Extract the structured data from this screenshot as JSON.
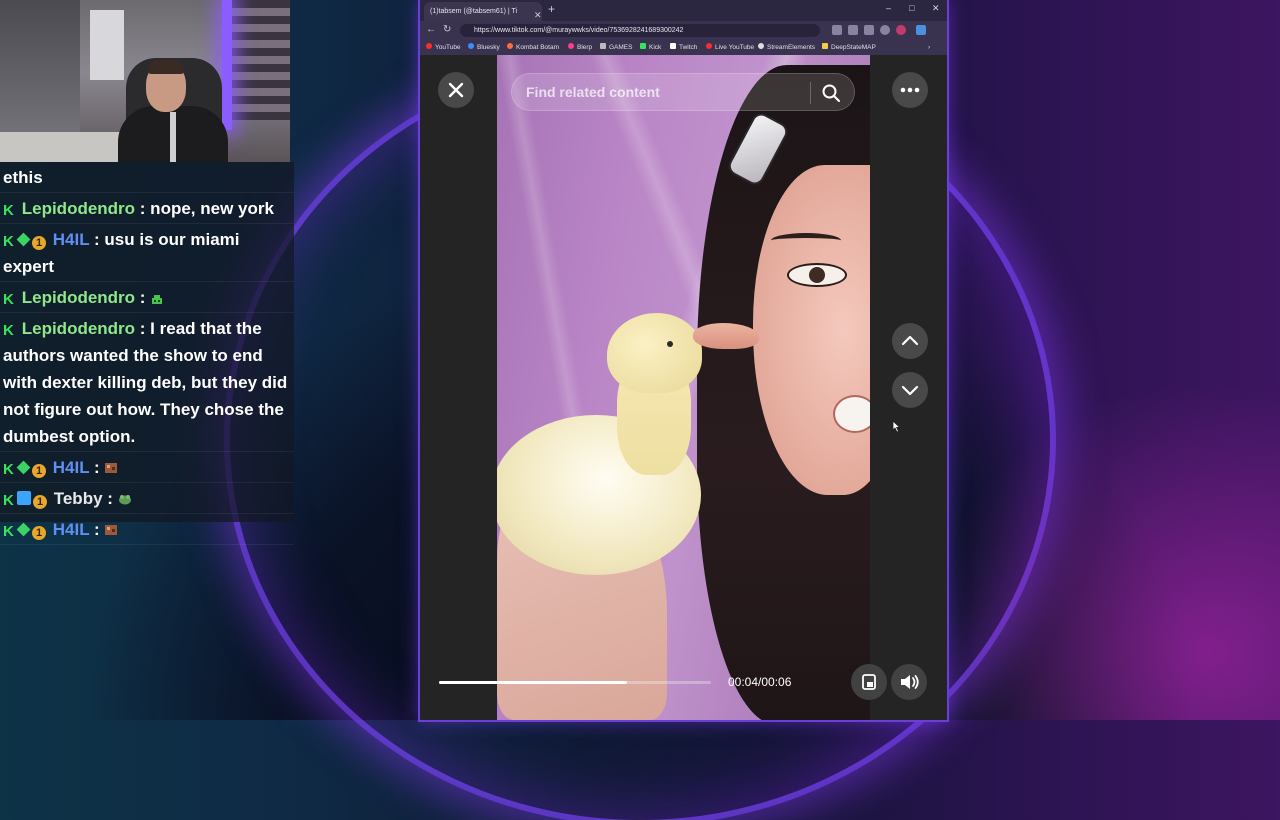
{
  "chat": {
    "messages": [
      {
        "user": "",
        "text": "ethis",
        "badges": []
      },
      {
        "user": "Lepidodendro",
        "text": ": nope, new york",
        "color": "green",
        "badges": [
          "k"
        ]
      },
      {
        "user": "H4IL",
        "text": ": usu is our miami expert",
        "color": "blue",
        "badges": [
          "k",
          "g",
          "c"
        ]
      },
      {
        "user": "Lepidodendro",
        "text": ":",
        "color": "green",
        "badges": [
          "k"
        ],
        "emote": "green-pixel-emote"
      },
      {
        "user": "Lepidodendro",
        "text": ": I read that the authors wanted the show to end with dexter killing deb, but they did not figure out how. They chose the dumbest option.",
        "color": "green",
        "badges": [
          "k"
        ]
      },
      {
        "user": "H4IL",
        "text": ":",
        "color": "blue",
        "badges": [
          "k",
          "g",
          "c"
        ],
        "emote": "brown-pixel-emote"
      },
      {
        "user": "Tebby",
        "text": ":",
        "color": "white",
        "badges": [
          "k",
          "cube",
          "c"
        ],
        "emote": "green-frog-emote"
      },
      {
        "user": "H4IL",
        "text": ":",
        "color": "blue",
        "badges": [
          "k",
          "g",
          "c"
        ],
        "emote": "brown-pixel-emote"
      }
    ]
  },
  "browser": {
    "tab_title": "(1)tabsem (@tabsem61) | Ti",
    "url": "https://www.tiktok.com/@muraywwks/video/7536928241689300242",
    "bookmarks": [
      "YouTube",
      "Bluesky",
      "Kombat Botam",
      "Blerp",
      "GAMES",
      "Kick",
      "Twitch",
      "Live YouTube",
      "StreamElements",
      "DeepStateMAP"
    ],
    "window_controls": [
      "–",
      "□",
      "✕"
    ]
  },
  "player": {
    "search_placeholder": "Find related content",
    "current_time": "00:04",
    "duration": "00:06",
    "time_display": "00:04/00:06",
    "progress": 0.69
  },
  "colors": {
    "accent": "#6a3fd6",
    "chat_green": "#8ee88a",
    "chat_blue": "#5f8ff0",
    "kick_green": "#36e35b"
  },
  "icons": {
    "close": "close-icon",
    "search": "search-icon",
    "more": "more-options-icon",
    "up": "chevron-up-icon",
    "down": "chevron-down-icon",
    "pip": "picture-in-picture-icon",
    "volume": "volume-icon"
  }
}
